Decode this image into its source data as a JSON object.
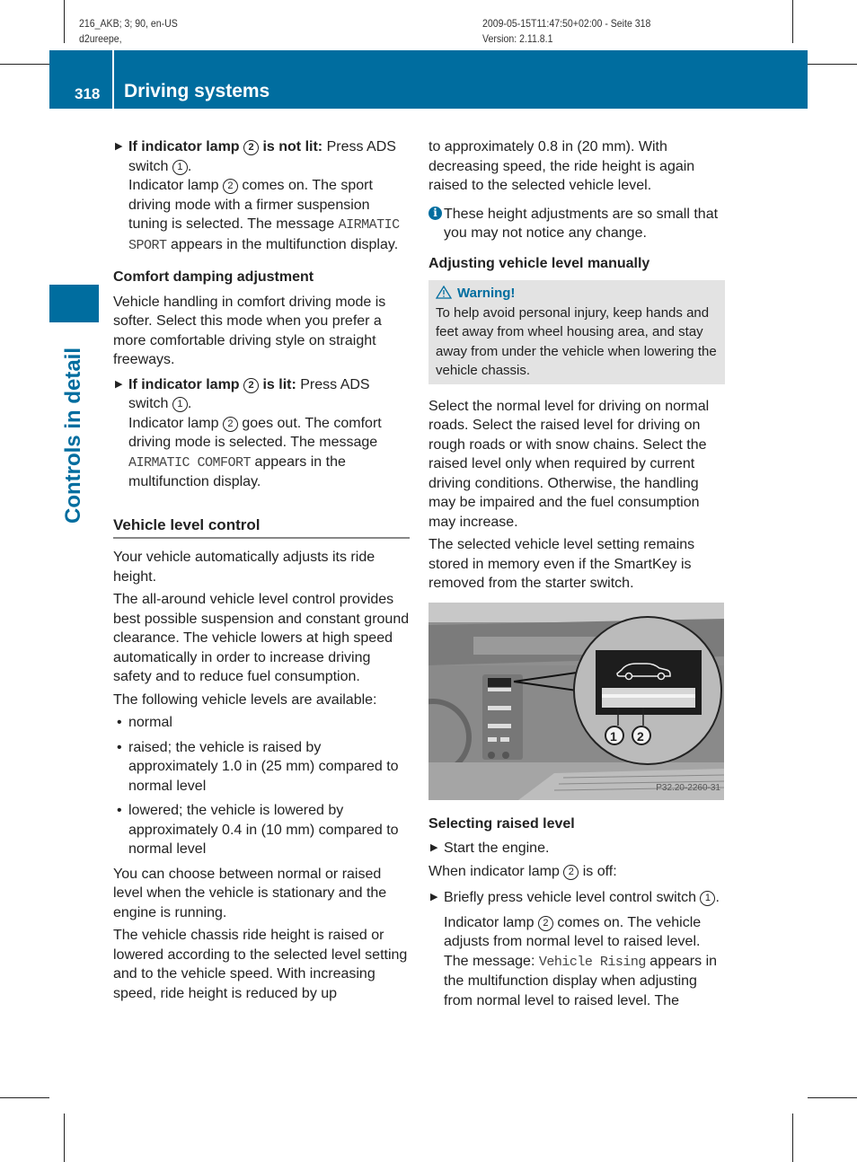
{
  "meta": {
    "left_line1": "216_AKB; 3; 90, en-US",
    "left_line2": "d2ureepe,",
    "right_line1": "2009-05-15T11:47:50+02:00 - Seite 318",
    "right_line2": "Version: 2.11.8.1"
  },
  "header": {
    "page_number": "318",
    "section_title": "Driving systems"
  },
  "side_tab": {
    "label": "Controls in detail"
  },
  "colors": {
    "accent": "#006d9f",
    "warning_bg": "#e3e3e3"
  },
  "left": {
    "step1": {
      "bold": "If indicator lamp ",
      "num2": "2",
      "bold2": " is not lit:",
      "text": " Press ADS switch ",
      "num1": "1",
      "end": "."
    },
    "step1_result": {
      "pre": "Indicator lamp ",
      "num": "2",
      "post": " comes on. The sport driving mode with a firmer suspension tuning is selected. The message ",
      "mono": "AIRMATIC SPORT",
      "post2": " appears in the multifunction display."
    },
    "comfort_heading": "Comfort damping adjustment",
    "comfort_text": "Vehicle handling in comfort driving mode is softer. Select this mode when you prefer a more comfortable driving style on straight freeways.",
    "step2": {
      "bold": "If indicator lamp ",
      "num2": "2",
      "bold2": " is lit:",
      "text": " Press ADS switch ",
      "num1": "1",
      "end": "."
    },
    "step2_result": {
      "pre": "Indicator lamp ",
      "num": "2",
      "post": " goes out. The comfort driving mode is selected. The message ",
      "mono": "AIRMATIC COMFORT",
      "post2": " appears in the multifunction display."
    },
    "vlc_heading": "Vehicle level control",
    "vlc_p1": "Your vehicle automatically adjusts its ride height.",
    "vlc_p2": "The all-around vehicle level control provides best possible suspension and constant ground clearance. The vehicle lowers at high speed automatically in order to increase driving safety and to reduce fuel consumption.",
    "vlc_p3": "The following vehicle levels are available:",
    "levels": [
      "normal",
      "raised; the vehicle is raised by approximately 1.0 in (25 mm) compared to normal level",
      "lowered; the vehicle is lowered by approximately 0.4 in (10 mm) compared to normal level"
    ],
    "vlc_p4": "You can choose between normal or raised level when the vehicle is stationary and the engine is running.",
    "vlc_p5": "The vehicle chassis ride height is raised or lowered according to the selected level setting and to the vehicle speed. With increasing speed, ride height is reduced by up"
  },
  "right": {
    "cont": "to approximately 0.8 in (20 mm). With decreasing speed, the ride height is again raised to the selected vehicle level.",
    "info": "These height adjustments are so small that you may not notice any change.",
    "manual_heading": "Adjusting vehicle level manually",
    "warning_title": "Warning!",
    "warning_text": "To help avoid personal injury, keep hands and feet away from wheel housing area, and stay away from under the vehicle when lowering the vehicle chassis.",
    "p1": "Select the normal level for driving on normal roads. Select the raised level for driving on rough roads or with snow chains. Select the raised level only when required by current driving conditions. Otherwise, the handling may be impaired and the fuel consumption may increase.",
    "p2": "The selected vehicle level setting remains stored in memory even if the SmartKey is removed from the starter switch.",
    "figure": {
      "callout1": "1",
      "callout2": "2",
      "code": "P32.20-2260-31"
    },
    "raised_heading": "Selecting raised level",
    "step_start": "Start the engine.",
    "when": {
      "pre": "When indicator lamp ",
      "num": "2",
      "post": " is off:"
    },
    "step_press": {
      "text": "Briefly press vehicle level control switch ",
      "num": "1",
      "end": "."
    },
    "result": {
      "pre": "Indicator lamp ",
      "num": "2",
      "post": " comes on. The vehicle adjusts from normal level to raised level. The message: ",
      "mono": "Vehicle Rising",
      "post2": " appears in the multifunction display when adjusting from normal level to raised level. The"
    }
  }
}
